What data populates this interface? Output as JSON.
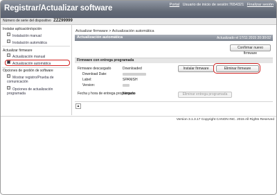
{
  "header": {
    "app_title": "Registrar/Actualizar software",
    "portal_link": "Portal",
    "login_user_label": "Usuario de inicio de sesión:7654321",
    "logout_link": "Finalizar sesión"
  },
  "device": {
    "serial_label": "Número de serie del dispositivo",
    "serial_value": "ZZZ99999"
  },
  "sidebar": {
    "categories": [
      "Instalar aplicación/opción",
      "Actualizar firmware",
      "Opciones de gestión de software"
    ],
    "items": [
      {
        "label": "Instalación manual"
      },
      {
        "label": "Instalación automática"
      },
      {
        "label": "Actualización manual"
      },
      {
        "label": "Actualización automática"
      },
      {
        "label": "Mostrar registro/Prueba de comunicación"
      },
      {
        "label": "Opciones de actualización programada"
      }
    ]
  },
  "main": {
    "breadcrumb": "Actualizar firmware > Actualización automática",
    "panel_title": "Actualización automática",
    "panel_updated": "Actualizado el 17/11 2015 20:30:02",
    "confirm_button": "Confirmar nuevo firmware",
    "section_title": "Firmware con entrega programada",
    "firmware_label": "Firmware descargado",
    "firmware_status": "Downloaded",
    "install_button": "Instalar firmware",
    "delete_button": "Eliminar firmware",
    "download_date_label": "Download Date:",
    "label_label": "Label:",
    "label_value": "SPANISH",
    "version_label": "Version:",
    "delivery_label": "Fecha y hora de entrega programada",
    "delivery_value": "Ninguno",
    "delete_schedule_button": "Eliminar entrega programada",
    "scroll_top_symbol": "▲"
  },
  "footer": {
    "copyright": "Version 3.1.3.17 Copyright CANON INC. 2015 All Rights Reserved"
  },
  "colors": {
    "header_gradient_top": "#8f96a2",
    "header_gradient_bottom": "#596070",
    "highlight_red": "#d0201f"
  }
}
